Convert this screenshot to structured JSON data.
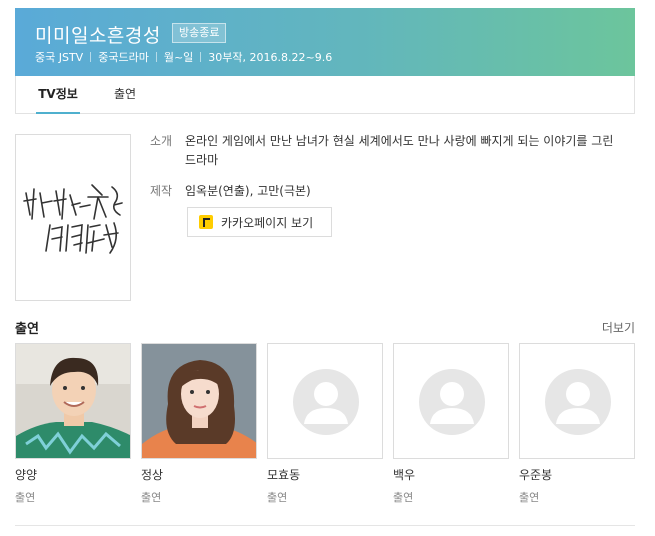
{
  "header": {
    "title": "미미일소흔경성",
    "badge": "방송종료",
    "country": "중국 JSTV",
    "genre": "중국드라마",
    "days": "월~일",
    "episodes_dates": "30부작, 2016.8.22~9.6"
  },
  "tabs": [
    {
      "label": "TV정보",
      "active": true
    },
    {
      "label": "출연",
      "active": false
    }
  ],
  "poster": {
    "logo_text": "微微一笑很傾城"
  },
  "info": {
    "synopsis_label": "소개",
    "synopsis": "온라인 게임에서 만난 남녀가 현실 세계에서도 만나 사랑에 빠지게 되는 이야기를 그린 드라마",
    "credits_label": "제작",
    "credits": "임옥분(연출), 고만(극본)",
    "kakao_button": "카카오페이지 보기"
  },
  "cast_section": {
    "title": "출연",
    "more": "더보기",
    "members": [
      {
        "name": "양양",
        "role": "출연",
        "photo": "actor-photo"
      },
      {
        "name": "정상",
        "role": "출연",
        "photo": "actress-photo"
      },
      {
        "name": "모효동",
        "role": "출연",
        "photo": "placeholder"
      },
      {
        "name": "백우",
        "role": "출연",
        "photo": "placeholder"
      },
      {
        "name": "우준봉",
        "role": "출연",
        "photo": "placeholder"
      }
    ]
  },
  "colors": {
    "header_gradient_start": "#5aaad8",
    "header_gradient_end": "#6cc59c",
    "tab_underline": "#4fb0ce",
    "kakao_yellow": "#ffcd00"
  }
}
